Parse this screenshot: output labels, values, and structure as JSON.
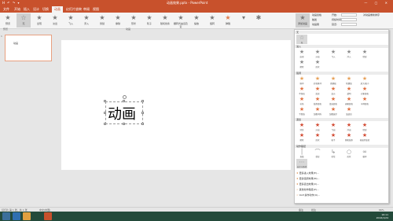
{
  "window": {
    "title": "动画效果.pptx - PowerPoint",
    "quick_access": "H ↶ ↷ ▾",
    "buttons": "— ▢ ✕"
  },
  "tabs": [
    "文件",
    "开始",
    "插入",
    "设计",
    "切换",
    "动画",
    "幻灯片放映",
    "审阅",
    "视图"
  ],
  "active_tab_index": 5,
  "ribbon": {
    "preview": "预览",
    "effects": [
      "无",
      "出现",
      "淡出",
      "飞入",
      "浮入",
      "劈裂",
      "擦除",
      "形状",
      "轮子",
      "随机线条",
      "翻转式由远及近",
      "缩放",
      "旋转",
      "弹跳"
    ],
    "add_animation": "添加动画",
    "animation_pane": "动画窗格",
    "trigger": "触发",
    "painter": "动画刷",
    "start": "开始:",
    "duration": "持续时间:",
    "delay": "延迟:",
    "reorder": "对动画重新排序"
  },
  "group_labels": {
    "preview": "预览",
    "animation": "动画",
    "timing": "计时"
  },
  "slide": {
    "number": "1",
    "thumb_text": "动画",
    "main_text": "动画"
  },
  "gallery": {
    "sections": {
      "none": "无",
      "entrance": "进入",
      "emphasis": "强调",
      "exit": "退出",
      "motion": "动作路径"
    },
    "none_items": [
      "无",
      "出现",
      "淡出",
      "飞入"
    ],
    "entrance_items": [
      "出现",
      "淡出",
      "飞入",
      "浮入",
      "劈裂",
      "擦除",
      "形状",
      "轮子",
      "随机线条",
      "翻转式由远及近",
      "缩放",
      "旋转",
      "弹跳"
    ],
    "emphasis_items": [
      "脉冲",
      "彩色脉冲",
      "跷跷板",
      "陀螺旋",
      "放大/缩小",
      "不饱和",
      "加深",
      "变淡",
      "透明",
      "对象颜色",
      "补色",
      "线条颜色",
      "填充颜色",
      "画笔颜色",
      "字体颜色",
      "下划线",
      "加粗闪烁",
      "加粗展示",
      "波浪形"
    ],
    "exit_items": [
      "消失",
      "淡出",
      "飞出",
      "浮出",
      "劈裂",
      "擦除",
      "形状",
      "轮子",
      "随机线条",
      "收缩并旋转",
      "缩放",
      "旋转",
      "弹跳"
    ],
    "motion_items": [
      "直线",
      "弧形",
      "转弯",
      "形状",
      "循环",
      "自定义路径"
    ],
    "more": [
      "更多进入效果(E)...",
      "更多强调效果(M)...",
      "更多退出效果(X)...",
      "其他动作路径(P)...",
      "OLE 操作动作(O)..."
    ]
  },
  "status": {
    "left": "幻灯片 第 1 张，共 1 张",
    "lang": "中文(中国)",
    "notes": "备注",
    "comments": "批注",
    "zoom": "66%"
  },
  "clock": {
    "time": "16:11",
    "date": "2016/1/24"
  },
  "colors": {
    "accent": "#c8512c",
    "star_orange": "#e07040",
    "taskbar": "#234a3a"
  }
}
